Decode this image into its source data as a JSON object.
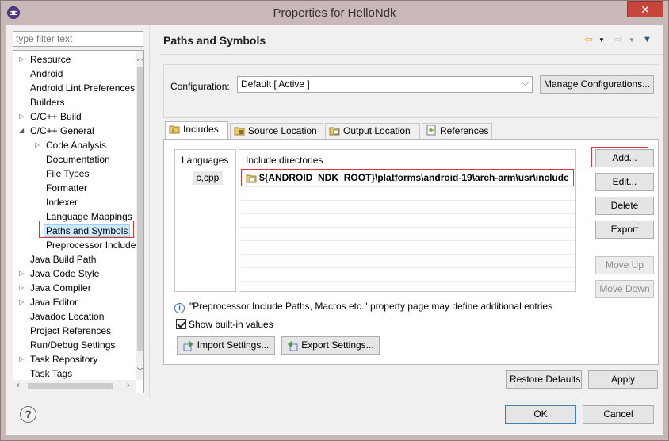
{
  "window": {
    "title": "Properties for HelloNdk",
    "close_label": "✕"
  },
  "filter": {
    "placeholder": "type filter text"
  },
  "tree": {
    "items": [
      {
        "label": "Resource",
        "indent": 1,
        "arrow": "right"
      },
      {
        "label": "Android",
        "indent": 1,
        "arrow": ""
      },
      {
        "label": "Android Lint Preferences",
        "indent": 1,
        "arrow": ""
      },
      {
        "label": "Builders",
        "indent": 1,
        "arrow": ""
      },
      {
        "label": "C/C++ Build",
        "indent": 1,
        "arrow": "right"
      },
      {
        "label": "C/C++ General",
        "indent": 1,
        "arrow": "down"
      },
      {
        "label": "Code Analysis",
        "indent": 2,
        "arrow": "right"
      },
      {
        "label": "Documentation",
        "indent": 2,
        "arrow": ""
      },
      {
        "label": "File Types",
        "indent": 2,
        "arrow": ""
      },
      {
        "label": "Formatter",
        "indent": 2,
        "arrow": ""
      },
      {
        "label": "Indexer",
        "indent": 2,
        "arrow": ""
      },
      {
        "label": "Language Mappings",
        "indent": 2,
        "arrow": ""
      },
      {
        "label": "Paths and Symbols",
        "indent": 2,
        "arrow": "",
        "selected": true
      },
      {
        "label": "Preprocessor Include Paths",
        "indent": 2,
        "arrow": ""
      },
      {
        "label": "Java Build Path",
        "indent": 1,
        "arrow": ""
      },
      {
        "label": "Java Code Style",
        "indent": 1,
        "arrow": "right"
      },
      {
        "label": "Java Compiler",
        "indent": 1,
        "arrow": "right"
      },
      {
        "label": "Java Editor",
        "indent": 1,
        "arrow": "right"
      },
      {
        "label": "Javadoc Location",
        "indent": 1,
        "arrow": ""
      },
      {
        "label": "Project References",
        "indent": 1,
        "arrow": ""
      },
      {
        "label": "Run/Debug Settings",
        "indent": 1,
        "arrow": ""
      },
      {
        "label": "Task Repository",
        "indent": 1,
        "arrow": "right"
      },
      {
        "label": "Task Tags",
        "indent": 1,
        "arrow": ""
      }
    ]
  },
  "page": {
    "title": "Paths and Symbols",
    "configuration_label": "Configuration:",
    "configuration_value": "Default  [ Active ]",
    "manage_button": "Manage Configurations..."
  },
  "tabs": [
    {
      "label": "Includes",
      "active": true
    },
    {
      "label": "Source Location",
      "active": false
    },
    {
      "label": "Output Location",
      "active": false
    },
    {
      "label": "References",
      "active": false
    }
  ],
  "includes": {
    "languages_header": "Languages",
    "languages": [
      "c,cpp"
    ],
    "directories_header": "Include directories",
    "directories": [
      "${ANDROID_NDK_ROOT}\\platforms\\android-19\\arch-arm\\usr\\include"
    ],
    "buttons": {
      "add": "Add...",
      "edit": "Edit...",
      "delete": "Delete",
      "export": "Export",
      "move_up": "Move Up",
      "move_down": "Move Down"
    },
    "info": "\"Preprocessor Include Paths, Macros etc.\" property page may define additional entries",
    "show_builtin": "Show built-in values",
    "import_settings": "Import Settings...",
    "export_settings": "Export Settings..."
  },
  "footer": {
    "restore_defaults": "Restore Defaults",
    "apply": "Apply",
    "ok": "OK",
    "cancel": "Cancel"
  },
  "colors": {
    "highlight_box": "#d23a3a",
    "selection": "#cde8ff"
  }
}
